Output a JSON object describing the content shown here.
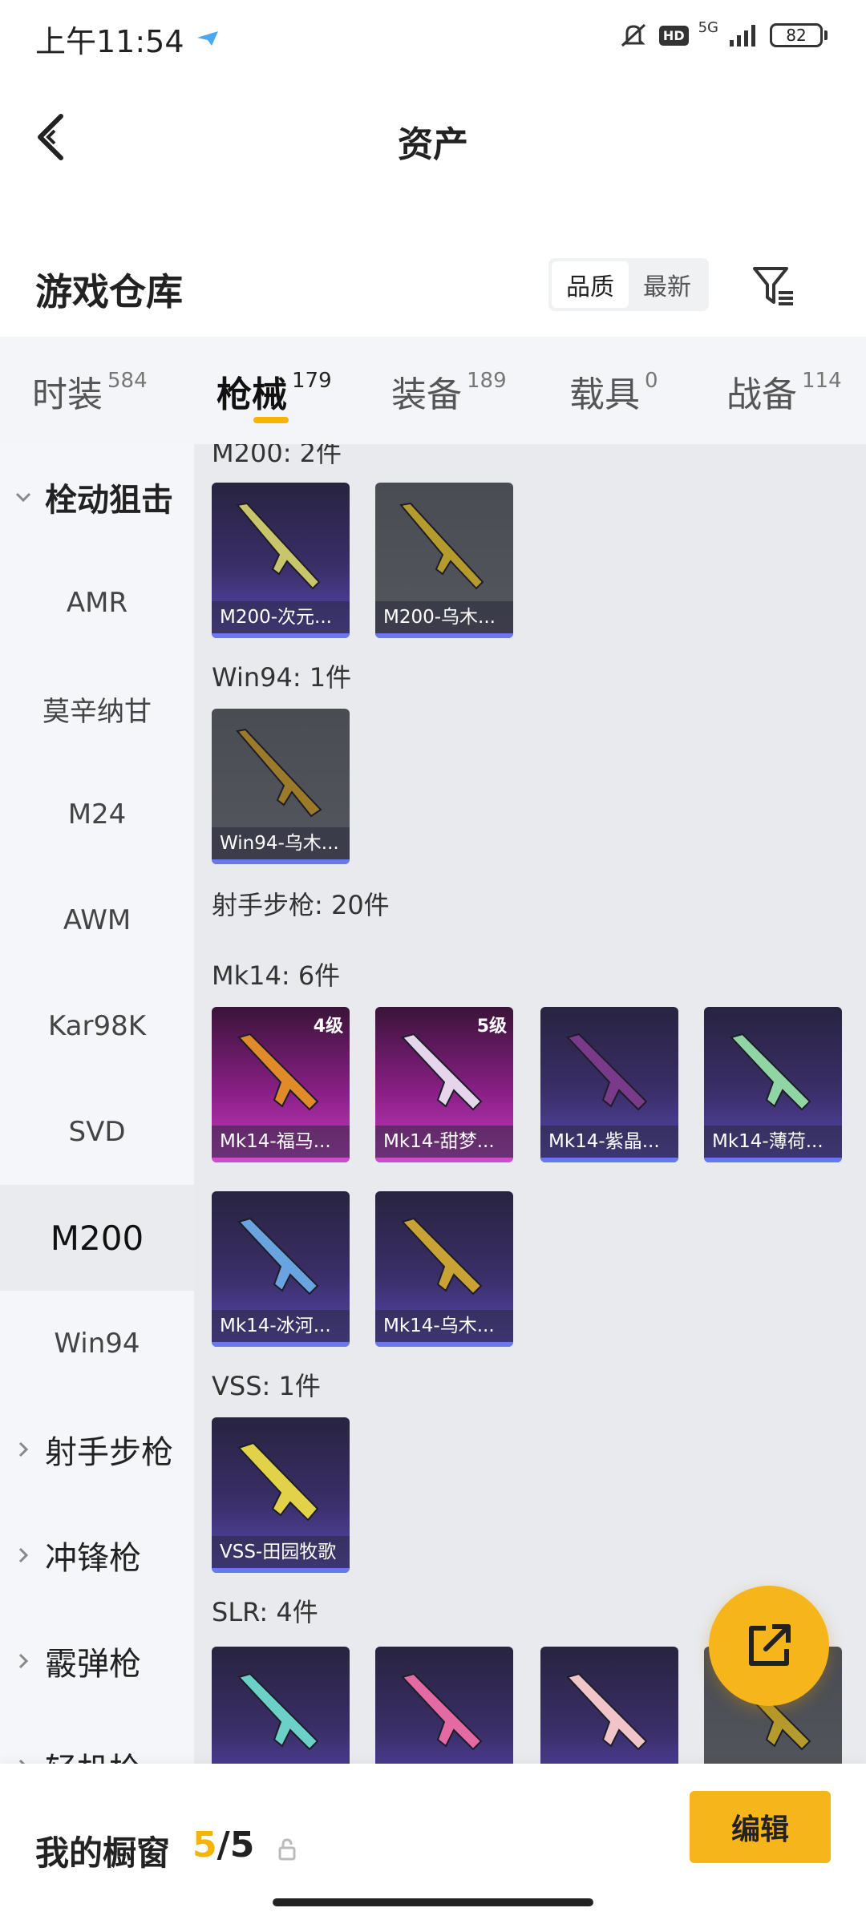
{
  "status_bar": {
    "time": "上午11:54",
    "hd": "HD",
    "network": "5G",
    "battery": "82"
  },
  "nav": {
    "title": "资产"
  },
  "warehouse": {
    "title": "游戏仓库",
    "sort_options": [
      "品质",
      "最新"
    ],
    "sort_selected": "品质"
  },
  "tabs": [
    {
      "label": "时装",
      "count": "584"
    },
    {
      "label": "枪械",
      "count": "179",
      "active": true
    },
    {
      "label": "装备",
      "count": "189"
    },
    {
      "label": "载具",
      "count": "0"
    },
    {
      "label": "战备",
      "count": "114"
    }
  ],
  "sidebar": {
    "groups": [
      {
        "label": "栓动狙击",
        "expanded": true
      },
      {
        "label": "射手步枪"
      },
      {
        "label": "冲锋枪"
      },
      {
        "label": "霰弹枪"
      },
      {
        "label": "轻机枪"
      }
    ],
    "items": [
      "AMR",
      "莫辛纳甘",
      "M24",
      "AWM",
      "Kar98K",
      "SVD",
      "M200",
      "Win94"
    ],
    "selected": "M200"
  },
  "content": {
    "sections": [
      {
        "label": "M200: 2件",
        "cards": [
          {
            "name": "M200-次元...",
            "style": "purple"
          },
          {
            "name": "M200-乌木...",
            "style": "gray"
          }
        ]
      },
      {
        "label": "Win94: 1件",
        "cards": [
          {
            "name": "Win94-乌木...",
            "style": "gray"
          }
        ]
      },
      {
        "label": "射手步枪: 20件"
      },
      {
        "label": "Mk14: 6件",
        "cards": [
          {
            "name": "Mk14-福马...",
            "style": "magenta",
            "level": "4级"
          },
          {
            "name": "Mk14-甜梦...",
            "style": "magenta",
            "level": "5级"
          },
          {
            "name": "Mk14-紫晶...",
            "style": "purple"
          },
          {
            "name": "Mk14-薄荷...",
            "style": "purple"
          },
          {
            "name": "Mk14-冰河...",
            "style": "purple"
          },
          {
            "name": "Mk14-乌木...",
            "style": "purple"
          }
        ]
      },
      {
        "label": "VSS: 1件",
        "cards": [
          {
            "name": "VSS-田园牧歌",
            "style": "purple"
          }
        ]
      },
      {
        "label": "SLR: 4件"
      }
    ]
  },
  "bottom": {
    "showcase_label": "我的橱窗",
    "showcase_current": "5",
    "showcase_sep": "/",
    "showcase_max": "5",
    "edit_label": "编辑"
  },
  "colors": {
    "accent": "#f7b51c",
    "tab_underline": "#f5b400",
    "card_purple": "#3a2f69",
    "card_magenta": "#c63ec0",
    "card_gray": "#55575e"
  }
}
